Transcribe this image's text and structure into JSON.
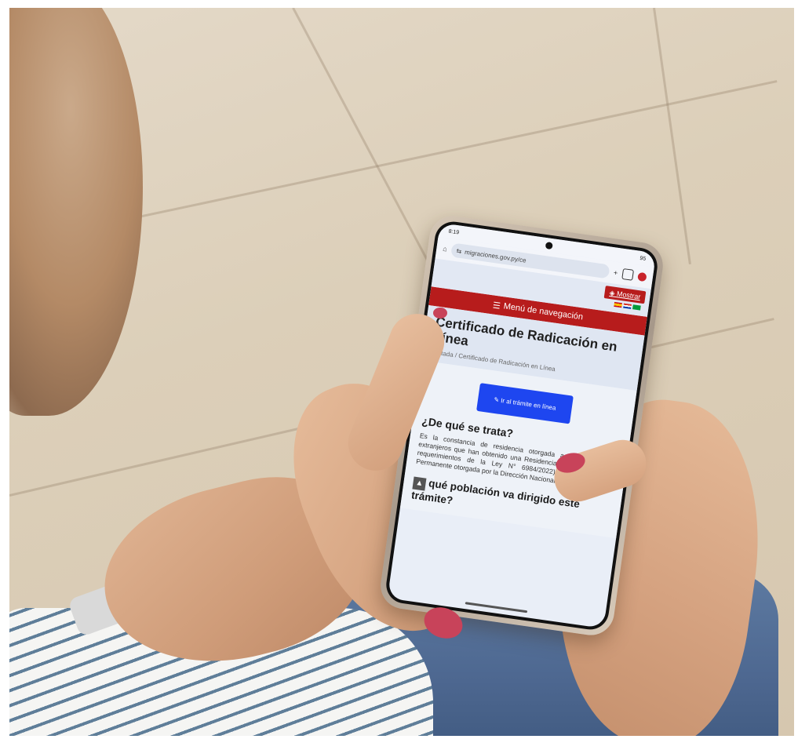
{
  "status": {
    "time": "8:19",
    "battery": "95"
  },
  "browser": {
    "url": "migraciones.gov.py/ce"
  },
  "site": {
    "show_button": "Mostrar",
    "nav_menu": "Menú de navegación",
    "page_title": "Certificado de Radicación en Línea",
    "breadcrumb": [
      "Portada",
      "Certificado de Radicación en Línea"
    ],
    "cta_button": "Ir al trámite en línea",
    "section1_title": "¿De qué se trata?",
    "section1_text": "Es la constancia de residencia otorgada a los ciudadanos extranjeros que han obtenido una Residencia Temporal (bajo los requerimientos de la Ley N° 6984/2022) ouna Residencia Permanente otorgada por la Dirección Nacional de Migraciones.",
    "section2_title": "qué población va dirigido este trámite?"
  },
  "colors": {
    "brand_red": "#b71c1c",
    "cta_blue": "#1e46f0"
  },
  "icons": [
    "home-icon",
    "tune-icon",
    "plus-icon",
    "tabs-icon",
    "menu-icon",
    "eye-slash-icon",
    "edit-icon",
    "scroll-up-icon"
  ]
}
